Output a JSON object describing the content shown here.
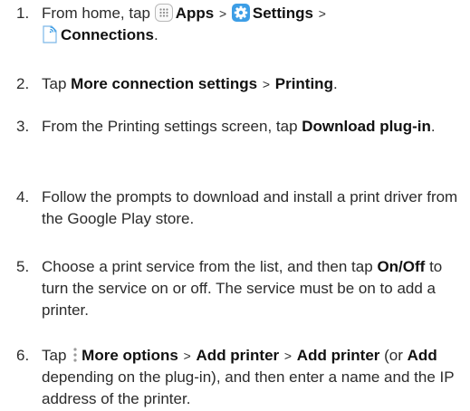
{
  "steps": [
    {
      "num": "1.",
      "t1": "From home, tap",
      "apps": "Apps",
      "sep1": ">",
      "settings": "Settings",
      "sep2": ">",
      "connections": "Connections",
      "end": "."
    },
    {
      "num": "2.",
      "t1": "Tap",
      "k1": "More connection settings",
      "sep1": ">",
      "k2": "Printing",
      "end": "."
    },
    {
      "num": "3.",
      "t1": "From the Printing settings screen, tap",
      "k1": "Download plug-in",
      "end": "."
    },
    {
      "num": "4.",
      "t1": "Follow the prompts to download and install a print driver from the Google Play store."
    },
    {
      "num": "5.",
      "t1": "Choose a print service from the list, and then tap",
      "k1": "On/Off",
      "t2": "to turn the service on or off. The service must be on to add a printer."
    },
    {
      "num": "6.",
      "t1": "Tap",
      "k1": "More options",
      "sep1": ">",
      "k2": "Add printer",
      "sep2": ">",
      "k3": "Add printer",
      "t2": "(or",
      "k4": "Add",
      "t3": "depending on the plug-in), and then enter a name and the IP address of the printer."
    }
  ],
  "colors": {
    "text": "#2b2b2b",
    "keyword": "#111111",
    "settings_icon_bg": "#3d9ee6",
    "connections_icon": "#3d9ee6"
  },
  "icons": [
    "apps-icon",
    "settings-icon",
    "connections-icon",
    "more-options-icon"
  ]
}
